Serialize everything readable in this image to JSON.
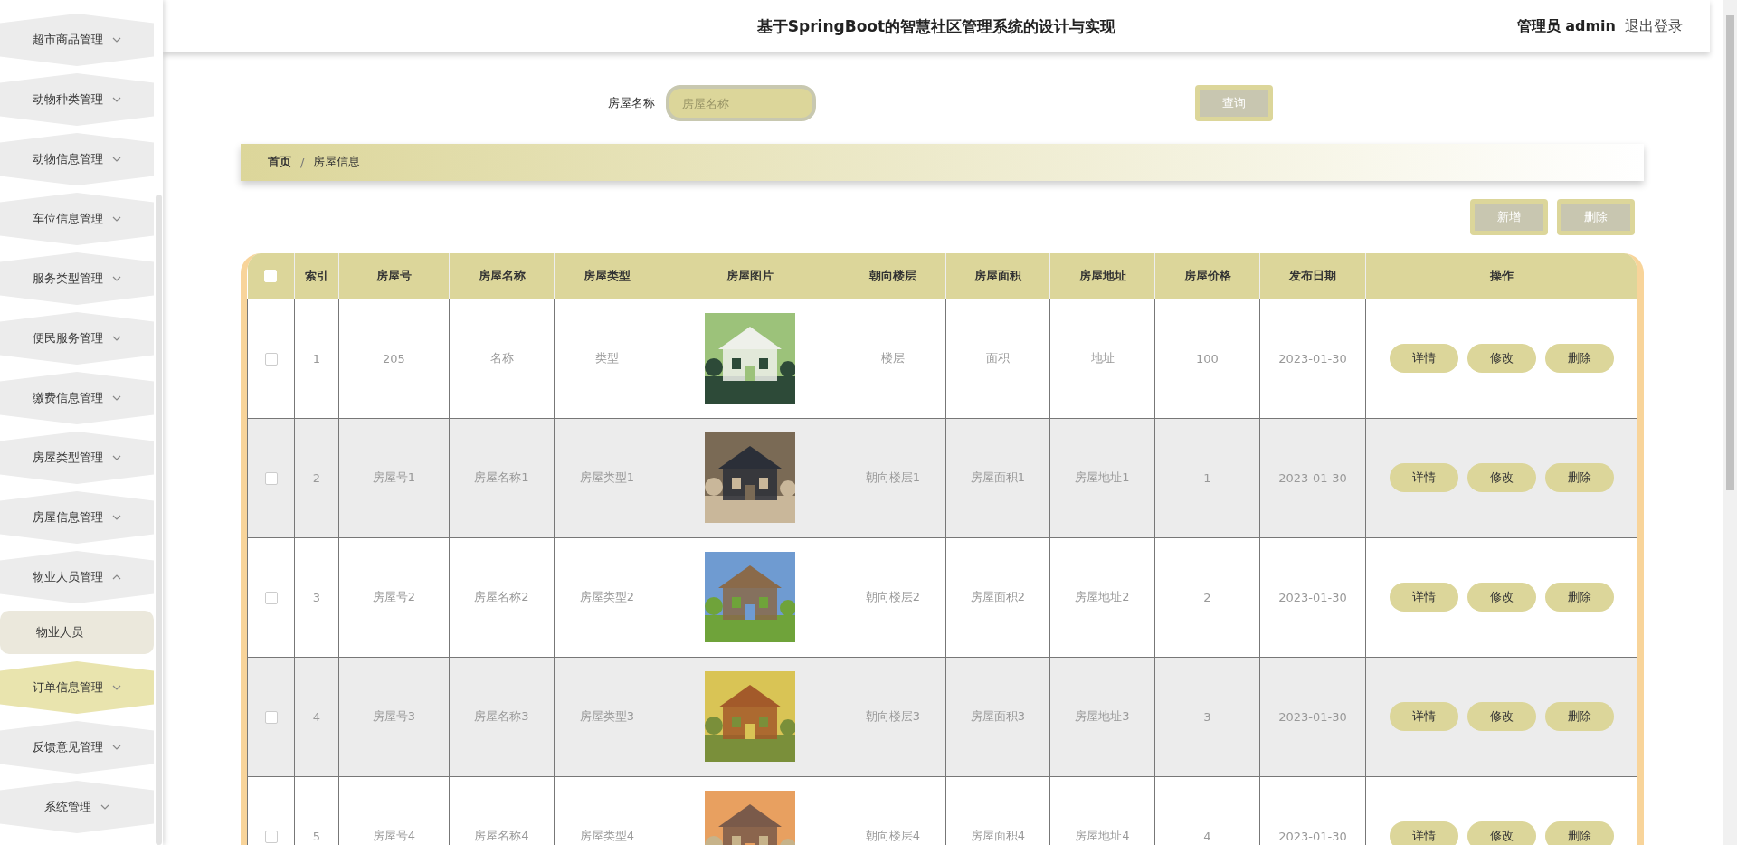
{
  "sidebar": {
    "items": [
      {
        "label": "超市商品管理",
        "expanded": false,
        "highlighted": false
      },
      {
        "label": "动物种类管理",
        "expanded": false,
        "highlighted": false
      },
      {
        "label": "动物信息管理",
        "expanded": false,
        "highlighted": false
      },
      {
        "label": "车位信息管理",
        "expanded": false,
        "highlighted": false
      },
      {
        "label": "服务类型管理",
        "expanded": false,
        "highlighted": false
      },
      {
        "label": "便民服务管理",
        "expanded": false,
        "highlighted": false
      },
      {
        "label": "缴费信息管理",
        "expanded": false,
        "highlighted": false
      },
      {
        "label": "房屋类型管理",
        "expanded": false,
        "highlighted": false
      },
      {
        "label": "房屋信息管理",
        "expanded": false,
        "highlighted": false
      },
      {
        "label": "物业人员管理",
        "expanded": true,
        "highlighted": false,
        "children": [
          {
            "label": "物业人员"
          }
        ]
      },
      {
        "label": "订单信息管理",
        "expanded": false,
        "highlighted": true
      },
      {
        "label": "反馈意见管理",
        "expanded": false,
        "highlighted": false
      },
      {
        "label": "系统管理",
        "expanded": false,
        "highlighted": false
      }
    ]
  },
  "header": {
    "title": "基于SpringBoot的智慧社区管理系统的设计与实现",
    "user": "管理员 admin",
    "logout": "退出登录"
  },
  "search": {
    "label": "房屋名称",
    "placeholder": "房屋名称",
    "button": "查询"
  },
  "breadcrumb": {
    "items": [
      "首页",
      "房屋信息"
    ],
    "separator": "/"
  },
  "actions": [
    "新增",
    "删除"
  ],
  "table": {
    "select_all": {
      "checked": false
    },
    "columns": [
      "索引",
      "房屋号",
      "房屋名称",
      "房屋类型",
      "房屋图片",
      "朝向楼层",
      "房屋面积",
      "房屋地址",
      "房屋价格",
      "发布日期",
      "操作"
    ],
    "rows": [
      {
        "checked": false,
        "cells": [
          "1",
          "205",
          "名称",
          "类型",
          null,
          "楼层",
          "面积",
          "地址",
          "100",
          "2023-01-30"
        ],
        "picture": {
          "kind": "picture"
        },
        "buttons": [
          "详情",
          "修改",
          "删除"
        ]
      },
      {
        "checked": false,
        "cells": [
          "2",
          "房屋号1",
          "房屋名称1",
          "房屋类型1",
          null,
          "朝向楼层1",
          "房屋面积1",
          "房屋地址1",
          "1",
          "2023-01-30"
        ],
        "picture": {
          "kind": "picture"
        },
        "buttons": [
          "详情",
          "修改",
          "删除"
        ]
      },
      {
        "checked": false,
        "cells": [
          "3",
          "房屋号2",
          "房屋名称2",
          "房屋类型2",
          null,
          "朝向楼层2",
          "房屋面积2",
          "房屋地址2",
          "2",
          "2023-01-30"
        ],
        "picture": {
          "kind": "picture"
        },
        "buttons": [
          "详情",
          "修改",
          "删除"
        ]
      },
      {
        "checked": false,
        "cells": [
          "4",
          "房屋号3",
          "房屋名称3",
          "房屋类型3",
          null,
          "朝向楼层3",
          "房屋面积3",
          "房屋地址3",
          "3",
          "2023-01-30"
        ],
        "picture": {
          "kind": "picture"
        },
        "buttons": [
          "详情",
          "修改",
          "删除"
        ]
      },
      {
        "checked": false,
        "cells": [
          "5",
          "房屋号4",
          "房屋名称4",
          "房屋类型4",
          null,
          "朝向楼层4",
          "房屋面积4",
          "房屋地址4",
          "4",
          "2023-01-30"
        ],
        "picture": {
          "kind": "picture"
        },
        "buttons": [
          "详情",
          "修改",
          "删除"
        ]
      }
    ]
  }
}
